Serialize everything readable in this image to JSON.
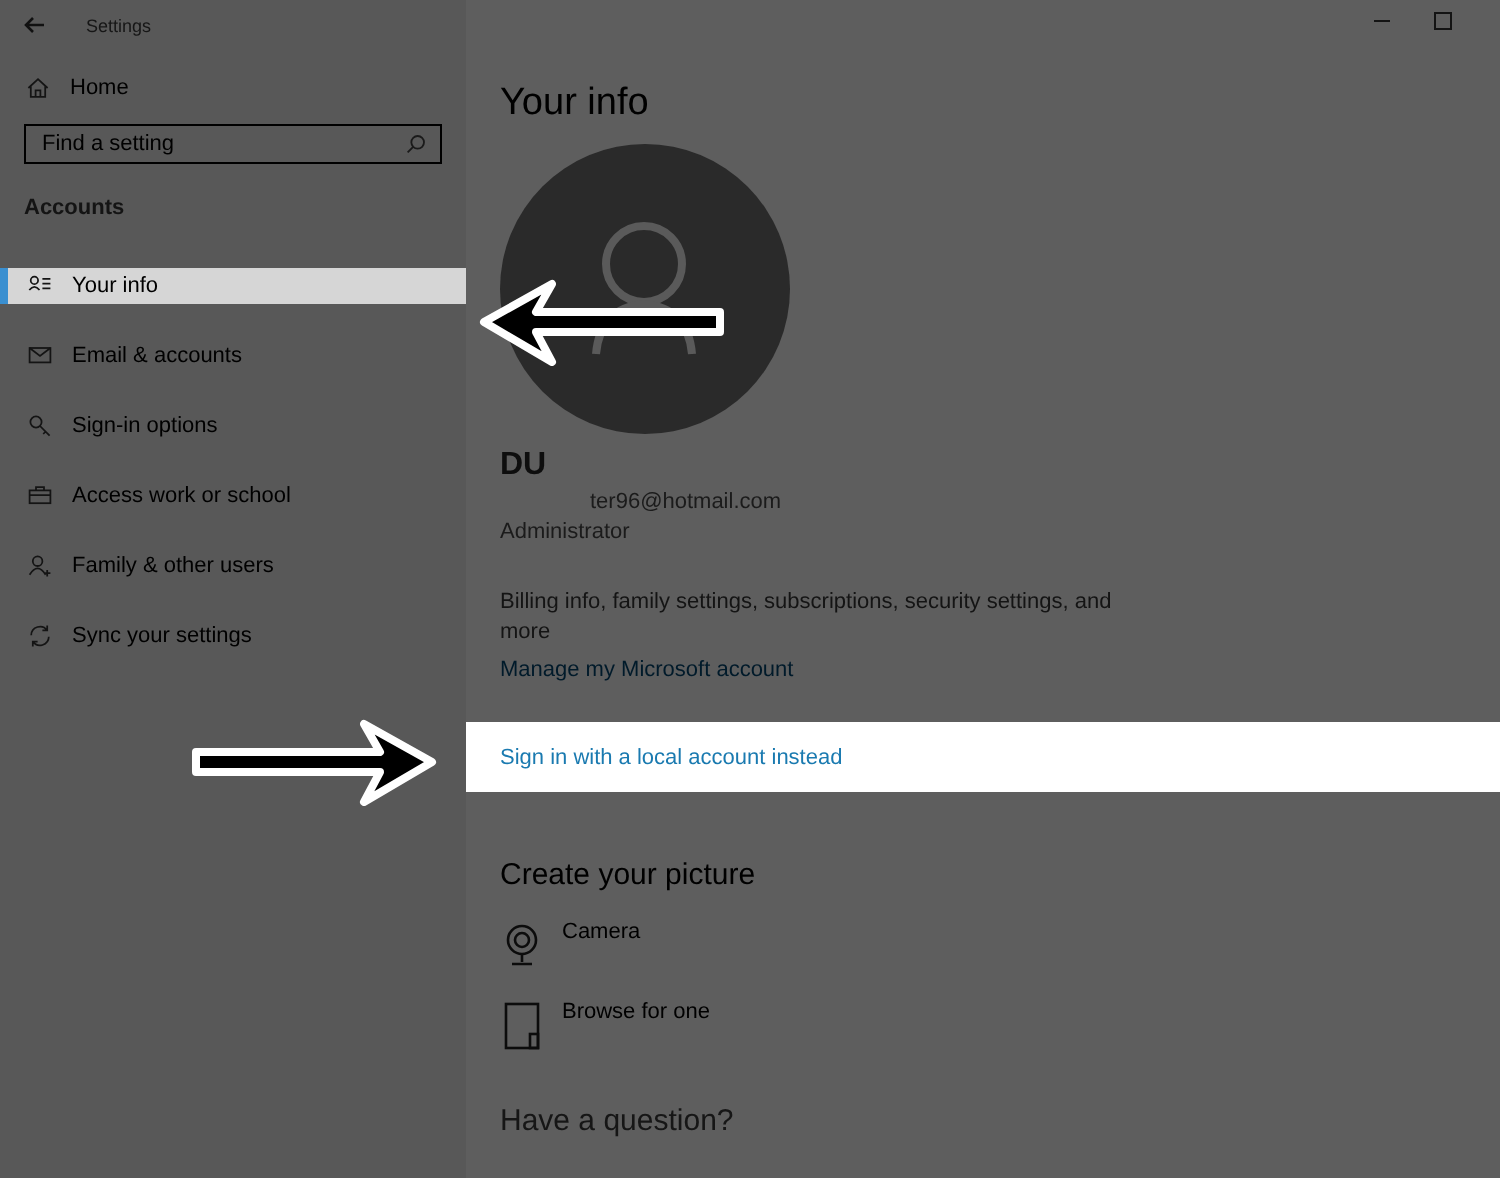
{
  "window": {
    "title": "Settings"
  },
  "sidebar": {
    "home": "Home",
    "search": {
      "placeholder": "Find a setting"
    },
    "section": "Accounts",
    "items": [
      {
        "label": "Your info",
        "selected": true
      },
      {
        "label": "Email & accounts",
        "selected": false
      },
      {
        "label": "Sign-in options",
        "selected": false
      },
      {
        "label": "Access work or school",
        "selected": false
      },
      {
        "label": "Family & other users",
        "selected": false
      },
      {
        "label": "Sync your settings",
        "selected": false
      }
    ]
  },
  "main": {
    "title": "Your info",
    "account": {
      "name": "DU",
      "email": "ter96@hotmail.com",
      "role": "Administrator"
    },
    "description": "Billing info, family settings, subscriptions, security settings, and more",
    "manage_link": "Manage my Microsoft account",
    "local_link": {
      "text": "Sign in with a local account instead",
      "highlighted": true
    },
    "picture_section": {
      "title": "Create your picture",
      "options": [
        {
          "label": "Camera"
        },
        {
          "label": "Browse for one"
        }
      ]
    },
    "question_heading": "Have a question?"
  }
}
